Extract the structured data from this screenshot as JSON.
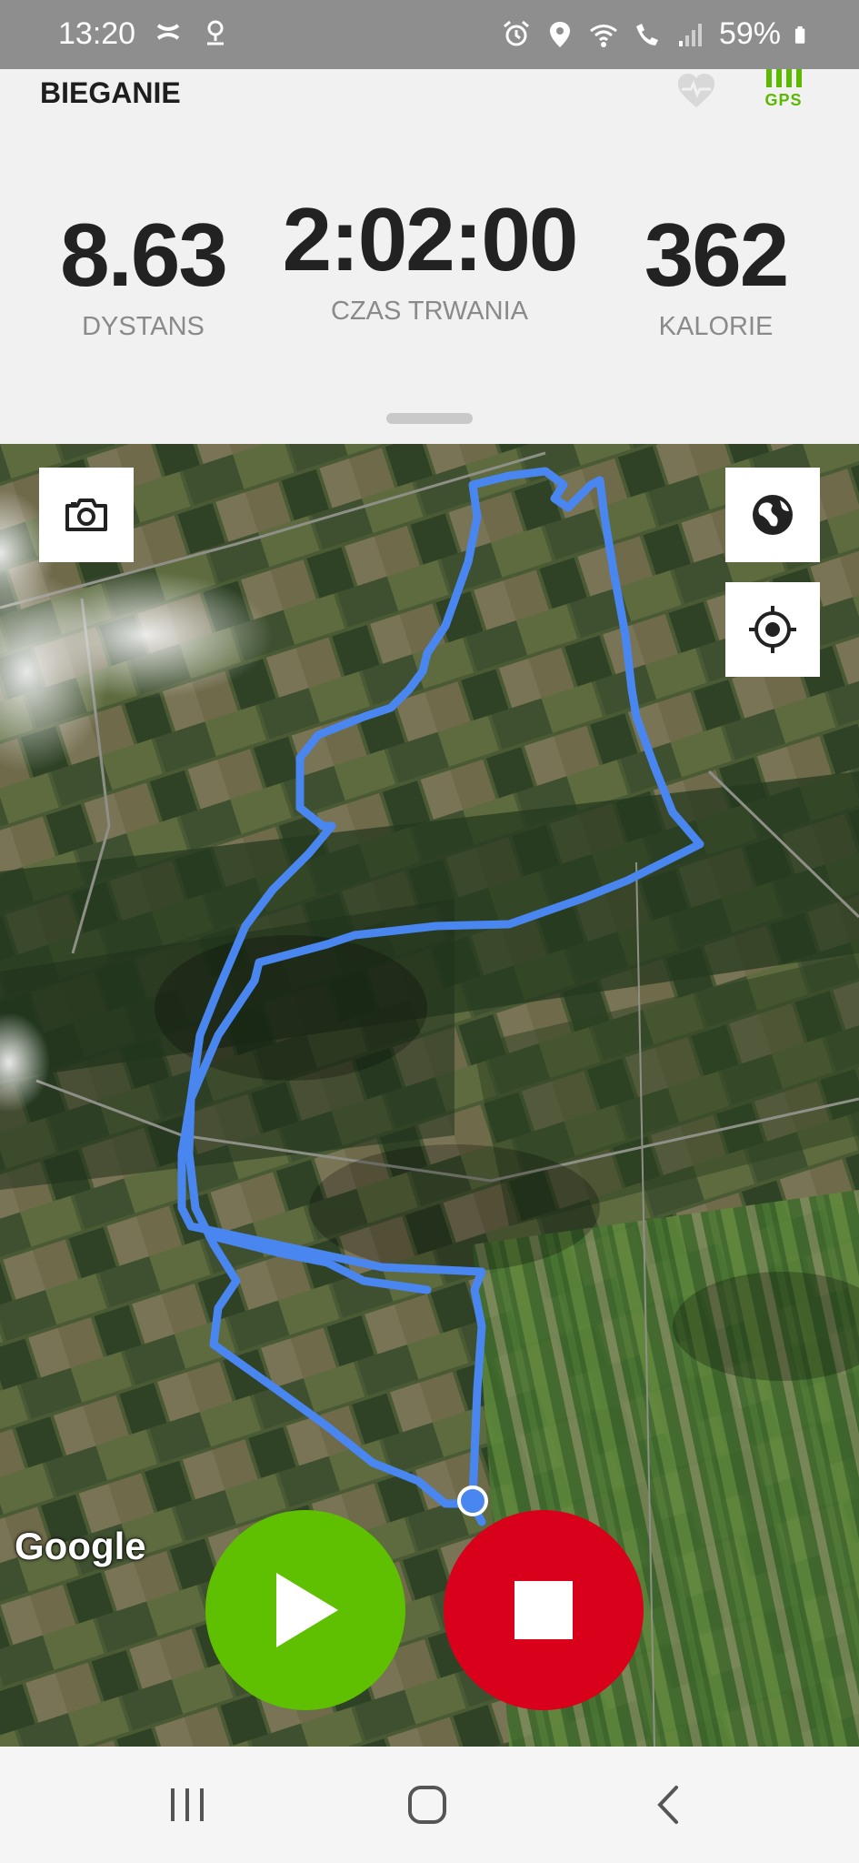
{
  "status_bar": {
    "time": "13:20",
    "battery": "59%",
    "icons_left": [
      "under-armour-icon",
      "location-pin-outline-icon"
    ],
    "icons_right": [
      "alarm-icon",
      "location-icon",
      "wifi-icon",
      "wifi-calling-icon",
      "signal-icon",
      "battery-icon"
    ]
  },
  "header": {
    "title": "BIEGANIE",
    "gps_label": "GPS",
    "icons": [
      "heart-rate-icon",
      "gps-signal-icon"
    ]
  },
  "stats": {
    "distance": {
      "value": "8.63",
      "label": "DYSTANS"
    },
    "duration": {
      "value": "2:02:00",
      "label": "CZAS TRWANIA"
    },
    "calories": {
      "value": "362",
      "label": "KALORIE"
    }
  },
  "map": {
    "attribution": "Google",
    "route_color": "#4a86f0",
    "buttons": [
      "camera-icon",
      "globe-icon",
      "crosshair-icon"
    ]
  },
  "controls": {
    "play_color": "#5ec000",
    "stop_color": "#d9001b"
  },
  "navigation": [
    "recent-apps-icon",
    "home-icon",
    "back-icon"
  ]
}
